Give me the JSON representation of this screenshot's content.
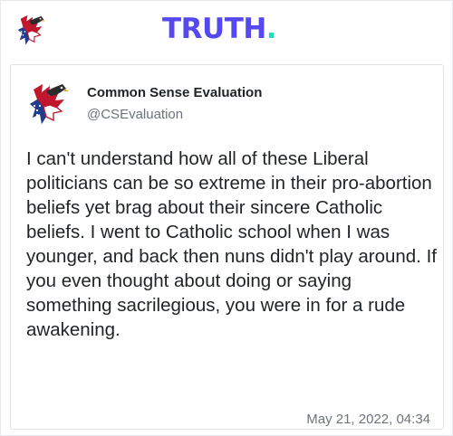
{
  "header": {
    "logo_icon": "eagle-flag-icon",
    "brand_text": "TRUTH",
    "brand_dot": ".",
    "brand_color": "#5448ee",
    "brand_dot_color": "#17e0c6"
  },
  "post": {
    "avatar_icon": "eagle-flag-icon",
    "display_name": "Common Sense Evaluation",
    "handle": "@CSEvaluation",
    "body": "I can't understand how all of these Liberal politicians can be so extreme in their pro-abortion beliefs yet brag about their sincere Catholic beliefs. I went to Catholic school when I was younger, and back then nuns didn't play around. If you even thought about doing or saying something sacrilegious, you were in for a rude awakening.",
    "timestamp": "May 21, 2022, 04:34"
  }
}
